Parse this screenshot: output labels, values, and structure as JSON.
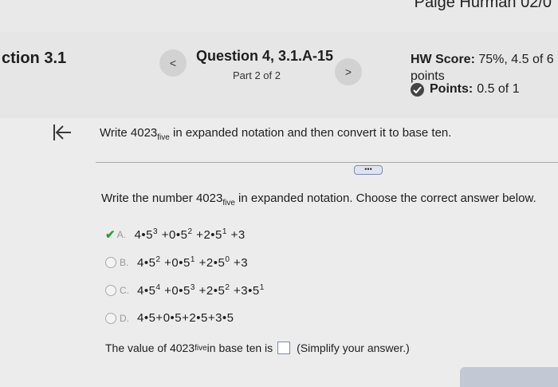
{
  "topbar": {
    "user": "Paige Hurman   02/0"
  },
  "header": {
    "section": "ction 3.1",
    "question_title": "Question 4, 3.1.A-15",
    "part": "Part 2 of 2",
    "prev_icon": "chevron-left",
    "next_icon": "chevron-right",
    "hw_label": "HW Score:",
    "hw_value": "75%, 4.5 of 6",
    "hw_value2": "points",
    "points_label": "Points:",
    "points_value": "0.5 of 1"
  },
  "content": {
    "back_icon": "back-to-start-arrow",
    "question_pre": "Write 4023",
    "question_sub": "five",
    "question_post": " in expanded notation and then convert it to base ten.",
    "more_label": "•••",
    "prompt_pre": "Write the number 4023",
    "prompt_sub": "five",
    "prompt_post": " in expanded notation. Choose the correct answer below.",
    "choices": [
      {
        "letter": "A.",
        "selected": true
      },
      {
        "letter": "B.",
        "selected": false
      },
      {
        "letter": "C.",
        "selected": false
      },
      {
        "letter": "D.",
        "selected": false
      }
    ],
    "value_pre": "The value of 4023",
    "value_sub": "five",
    "value_mid": " in base ten is",
    "value_post": "(Simplify your answer.)"
  }
}
